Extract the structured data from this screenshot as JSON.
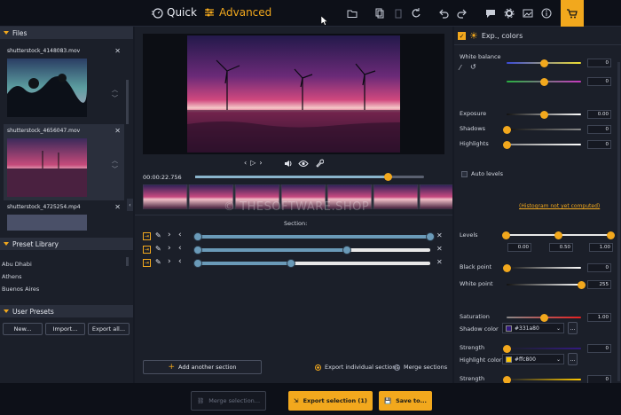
{
  "topbar": {
    "quick_label": "Quick",
    "advanced_label": "Advanced",
    "accent": "#f2a81d"
  },
  "files": {
    "header": "Files",
    "items": [
      {
        "name": "shutterstock_4148083.mov"
      },
      {
        "name": "shutterstock_4656047.mov"
      },
      {
        "name": "shutterstock_4725254.mp4"
      }
    ]
  },
  "preset_library": {
    "header": "Preset Library",
    "items": [
      "Abu Dhabi",
      "Athens",
      "Buenos Aires"
    ]
  },
  "user_presets": {
    "header": "User Presets",
    "new_label": "New...",
    "import_label": "Import...",
    "export_label": "Export all..."
  },
  "player": {
    "timecode": "00:00:22.756",
    "progress": 0.84
  },
  "watermark": "© THESOFTWARE.SHOP",
  "sections": {
    "title": "Section:",
    "rows": [
      {
        "start": 0.0,
        "end": 1.0
      },
      {
        "start": 0.0,
        "end": 0.64
      },
      {
        "start": 0.0,
        "end": 0.4
      }
    ],
    "add_label": "Add another section",
    "export_individual_label": "Export individual sections",
    "merge_label": "Merge sections"
  },
  "right_panel": {
    "header": "Exp., colors",
    "white_balance_label": "White balance",
    "wb1": {
      "value": "0",
      "pos": 0.5
    },
    "wb2": {
      "value": "0",
      "pos": 0.5
    },
    "exposure": {
      "label": "Exposure",
      "value": "0.00",
      "pos": 0.5
    },
    "shadows": {
      "label": "Shadows",
      "value": "0",
      "pos": 0.0
    },
    "highlights": {
      "label": "Highlights",
      "value": "0",
      "pos": 0.0
    },
    "auto_levels_label": "Auto levels",
    "histogram_text": "(Histogram not yet computed)",
    "levels": {
      "label": "Levels",
      "v1": "0.00",
      "v2": "0.50",
      "v3": "1.00"
    },
    "black_point": {
      "label": "Black point",
      "value": "0",
      "pos": 0.0
    },
    "white_point": {
      "label": "White point",
      "value": "255",
      "pos": 1.0
    },
    "saturation": {
      "label": "Saturation",
      "value": "1.00",
      "pos": 0.5
    },
    "shadow_color": {
      "label": "Shadow color",
      "hex": "#331a80",
      "color": "#331a80"
    },
    "strength1": {
      "label": "Strength",
      "value": "0",
      "pos": 0.0
    },
    "highlight_color": {
      "label": "Highlight color",
      "hex": "#ffc800",
      "color": "#ffc800"
    },
    "strength2": {
      "label": "Strength",
      "value": "0",
      "pos": 0.0
    }
  },
  "bottom": {
    "merge_label": "Merge selection...",
    "export_label": "Export selection (1)",
    "save_label": "Save to..."
  }
}
